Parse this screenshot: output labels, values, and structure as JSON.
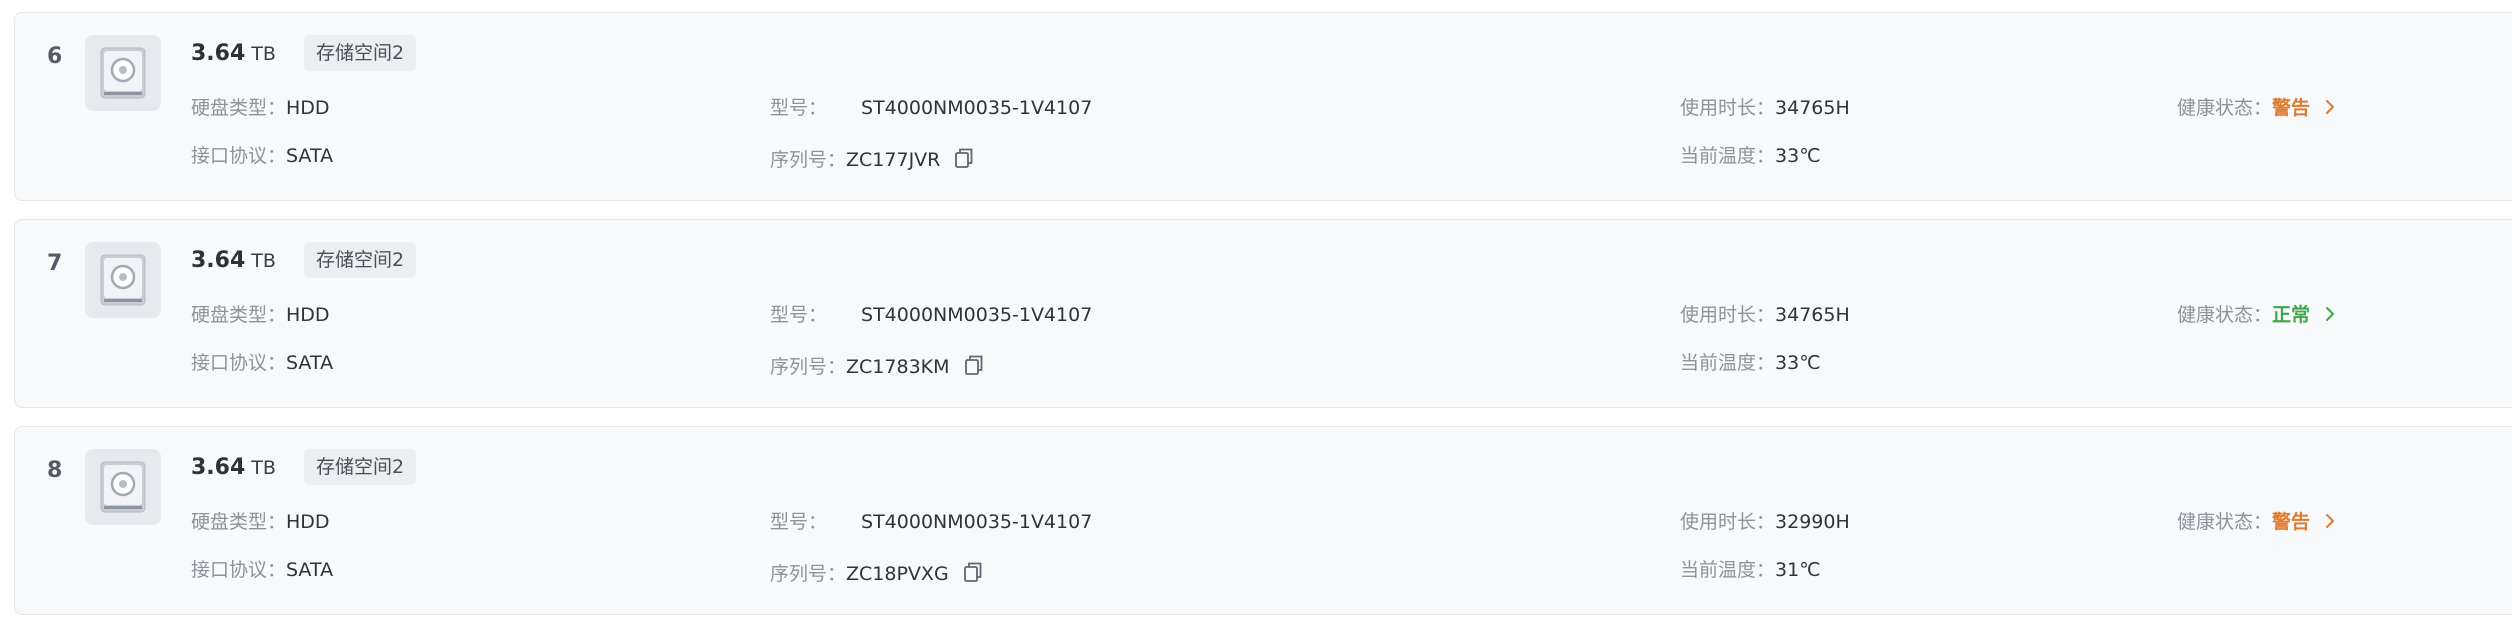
{
  "labels": {
    "disk_type": "硬盘类型：",
    "model": "型号：",
    "usage_hours": "使用时长：",
    "health": "健康状态：",
    "interface": "接口协议：",
    "serial": "序列号：",
    "temperature": "当前温度："
  },
  "disks": [
    {
      "index": "6",
      "capacity": "3.64",
      "capacity_unit": "TB",
      "pool": "存储空间2",
      "disk_type": "HDD",
      "model": "ST4000NM0035-1V4107",
      "usage_hours": "34765H",
      "health": "警告",
      "health_color": "#e07a2c",
      "interface": "SATA",
      "serial": "ZC177JVR",
      "temperature": "33℃"
    },
    {
      "index": "7",
      "capacity": "3.64",
      "capacity_unit": "TB",
      "pool": "存储空间2",
      "disk_type": "HDD",
      "model": "ST4000NM0035-1V4107",
      "usage_hours": "34765H",
      "health": "正常",
      "health_color": "#3fa64c",
      "interface": "SATA",
      "serial": "ZC1783KM",
      "temperature": "33℃"
    },
    {
      "index": "8",
      "capacity": "3.64",
      "capacity_unit": "TB",
      "pool": "存储空间2",
      "disk_type": "HDD",
      "model": "ST4000NM0035-1V4107",
      "usage_hours": "32990H",
      "health": "警告",
      "health_color": "#e07a2c",
      "interface": "SATA",
      "serial": "ZC18PVXG",
      "temperature": "31℃"
    }
  ],
  "icons": {
    "disk": "hard-drive-icon",
    "copy": "copy-icon",
    "detail": "chevron-right-icon"
  }
}
